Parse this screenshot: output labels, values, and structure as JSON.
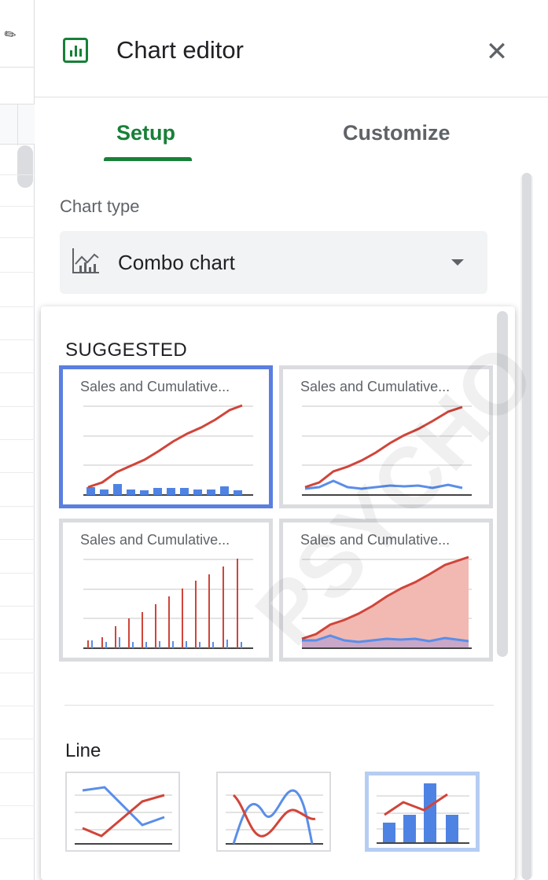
{
  "header": {
    "title": "Chart editor",
    "logo_icon": "bar-chart-icon",
    "close_icon": "close-icon",
    "close_glyph": "✕"
  },
  "tabs": [
    {
      "label": "Setup",
      "active": true
    },
    {
      "label": "Customize",
      "active": false
    }
  ],
  "chart_type": {
    "label": "Chart type",
    "value": "Combo chart",
    "icon": "combo-chart-icon"
  },
  "dropdown": {
    "suggested_label": "SUGGESTED",
    "suggestions": [
      {
        "title": "Sales and Cumulative...",
        "kind": "combo-bar-line",
        "selected": true
      },
      {
        "title": "Sales and Cumulative...",
        "kind": "two-lines",
        "selected": false
      },
      {
        "title": "Sales and Cumulative...",
        "kind": "column-spikes",
        "selected": false
      },
      {
        "title": "Sales and Cumulative...",
        "kind": "area",
        "selected": false
      }
    ],
    "line_section_label": "Line",
    "line_options": [
      {
        "kind": "line-chart",
        "selected": false
      },
      {
        "kind": "smooth-line-chart",
        "selected": false
      },
      {
        "kind": "combo-chart",
        "selected": true
      }
    ]
  },
  "colors": {
    "accent_green": "#188038",
    "selected_border": "#5b7fe0",
    "series_red": "#d0453a",
    "series_blue": "#5a8ee8",
    "area_fill": "#f2b9b3"
  },
  "watermark": "PSYCHO"
}
